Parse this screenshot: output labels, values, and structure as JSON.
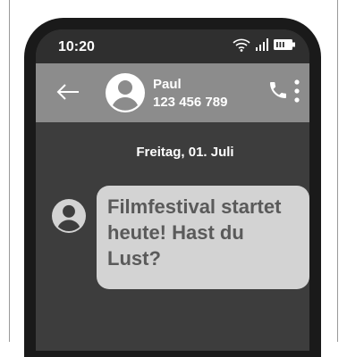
{
  "status": {
    "time": "10:20"
  },
  "contact": {
    "name": "Paul",
    "number": "123 456 789"
  },
  "conversation": {
    "date": "Freitag, 01. Juli",
    "messages": [
      {
        "text": "Filmfestival startet heute! Hast du Lust?"
      }
    ]
  },
  "icons": {
    "wifi": "wifi-icon",
    "signal": "signal-icon",
    "battery": "battery-icon",
    "back": "arrow-left-icon",
    "avatar": "person-icon",
    "call": "phone-icon",
    "more": "more-vertical-icon"
  },
  "colors": {
    "appbar": "#8c8c8c",
    "screen": "#3d3d3d",
    "bubble": "#d3d3d3",
    "bubble_text": "#5a5a5a"
  }
}
